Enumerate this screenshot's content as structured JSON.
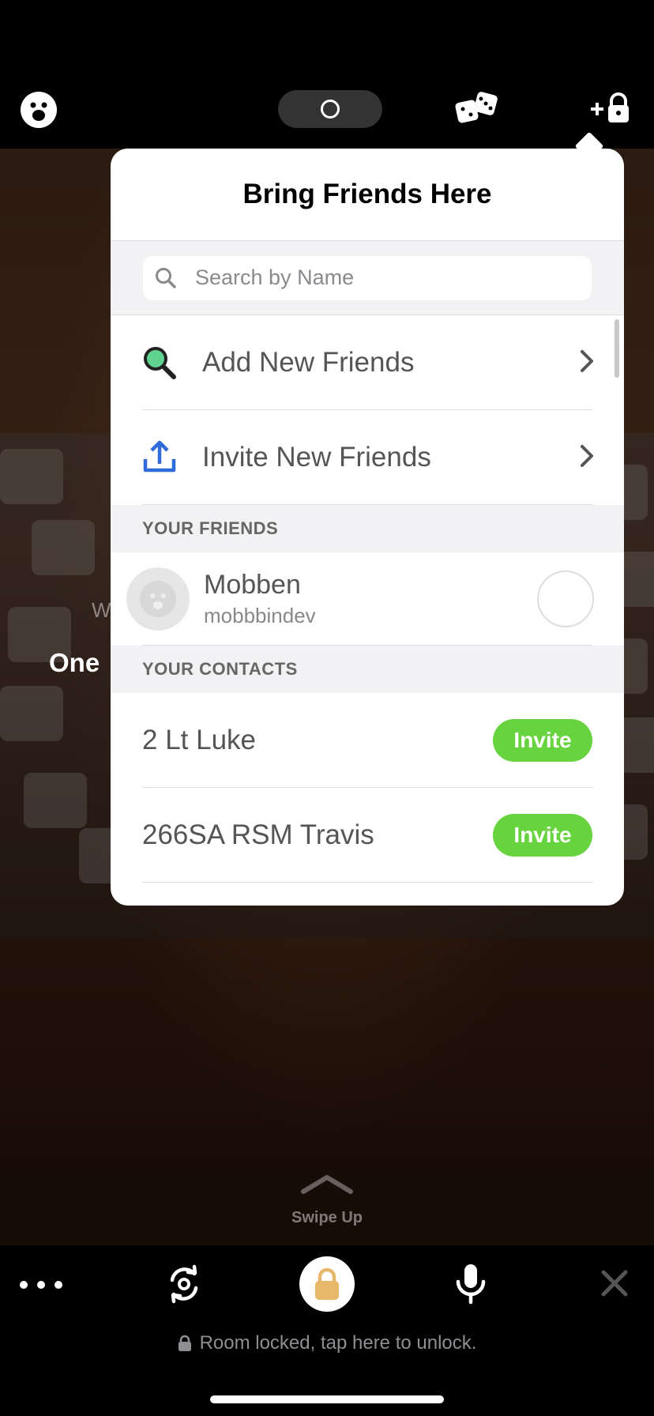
{
  "background": {
    "partial_text_1": "W",
    "partial_text_2": "One"
  },
  "topbar": {
    "icons": [
      "smiley-face-icon",
      "camera-switch-icon",
      "dice-icon",
      "add-lock-icon"
    ]
  },
  "popover": {
    "title": "Bring Friends Here",
    "search": {
      "placeholder": "Search by Name",
      "value": ""
    },
    "actions": [
      {
        "label": "Add New Friends",
        "icon": "magnifier-icon"
      },
      {
        "label": "Invite New Friends",
        "icon": "share-upload-icon"
      }
    ],
    "friends_header": "YOUR FRIENDS",
    "friends": [
      {
        "name": "Mobben",
        "username": "mobbbindev"
      }
    ],
    "contacts_header": "YOUR CONTACTS",
    "contacts": [
      {
        "name": "2 Lt Luke",
        "action": "Invite"
      },
      {
        "name": "266SA RSM Travis",
        "action": "Invite"
      }
    ],
    "accent_color": "#66d33f"
  },
  "swipe": {
    "label": "Swipe Up"
  },
  "bottombar": {
    "lock_message": "Room locked, tap here to unlock.",
    "lock_color": "#e8b86a"
  }
}
